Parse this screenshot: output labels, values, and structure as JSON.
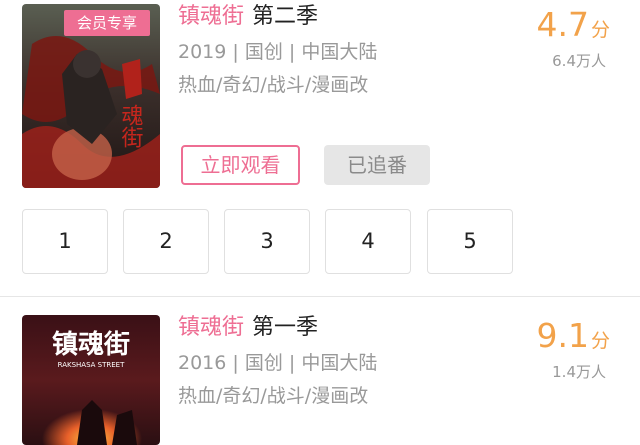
{
  "items": [
    {
      "badge": "会员专享",
      "title": "镇魂街",
      "season": "第二季",
      "meta": "2019 | 国创 | 中国大陆",
      "genres": "热血/奇幻/战斗/漫画改",
      "score": "4.7",
      "score_unit": "分",
      "views": "6.4万人",
      "watch_button": "立即观看",
      "follow_button": "已追番",
      "episodes": [
        "1",
        "2",
        "3",
        "4",
        "5"
      ],
      "poster_text": "魂街"
    },
    {
      "title": "镇魂街",
      "season": "第一季",
      "meta": "2016 | 国创 | 中国大陆",
      "genres": "热血/奇幻/战斗/漫画改",
      "score": "9.1",
      "score_unit": "分",
      "views": "1.4万人",
      "poster_title": "镇魂街",
      "poster_subtitle": "RAKSHASA STREET"
    }
  ],
  "colors": {
    "accent": "#ee6e93",
    "score": "#f2a24a",
    "muted": "#999999"
  }
}
